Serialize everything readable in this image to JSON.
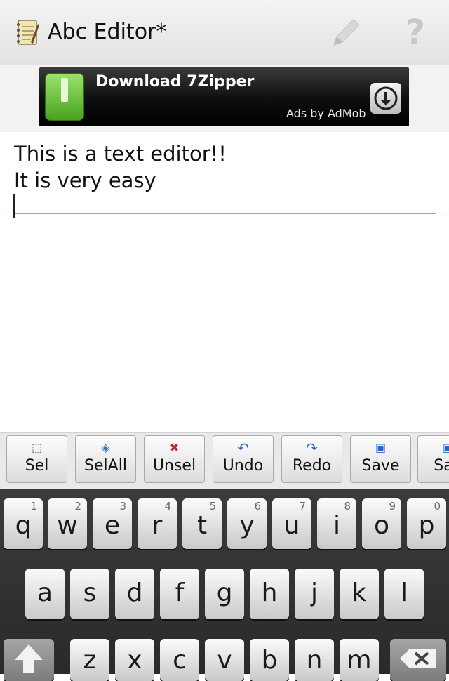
{
  "app": {
    "title": "Abc Editor*"
  },
  "ad": {
    "title": "Download 7Zipper",
    "byline": "Ads by AdMob"
  },
  "editor": {
    "lines": "This is a text editor!!\nIt is very easy"
  },
  "toolbar": {
    "buttons": [
      {
        "label": "Sel",
        "icon": "select-icon"
      },
      {
        "label": "SelAll",
        "icon": "select-all-icon"
      },
      {
        "label": "Unsel",
        "icon": "unselect-icon"
      },
      {
        "label": "Undo",
        "icon": "undo-icon"
      },
      {
        "label": "Redo",
        "icon": "redo-icon"
      },
      {
        "label": "Save",
        "icon": "save-icon"
      },
      {
        "label": "Sav",
        "icon": "save-as-icon"
      }
    ]
  },
  "keyboard": {
    "row1": [
      {
        "ch": "q",
        "num": "1"
      },
      {
        "ch": "w",
        "num": "2"
      },
      {
        "ch": "e",
        "num": "3"
      },
      {
        "ch": "r",
        "num": "4"
      },
      {
        "ch": "t",
        "num": "5"
      },
      {
        "ch": "y",
        "num": "6"
      },
      {
        "ch": "u",
        "num": "7"
      },
      {
        "ch": "i",
        "num": "8"
      },
      {
        "ch": "o",
        "num": "9"
      },
      {
        "ch": "p",
        "num": "0"
      }
    ],
    "row2": [
      "a",
      "s",
      "d",
      "f",
      "g",
      "h",
      "j",
      "k",
      "l"
    ],
    "row3": [
      "z",
      "x",
      "c",
      "v",
      "b",
      "n",
      "m"
    ],
    "shift_icon": "shift-icon",
    "backspace_icon": "backspace-icon"
  },
  "colors": {
    "caret_line": "#66b8d8",
    "keyboard_bg": "#2f2f2f"
  }
}
